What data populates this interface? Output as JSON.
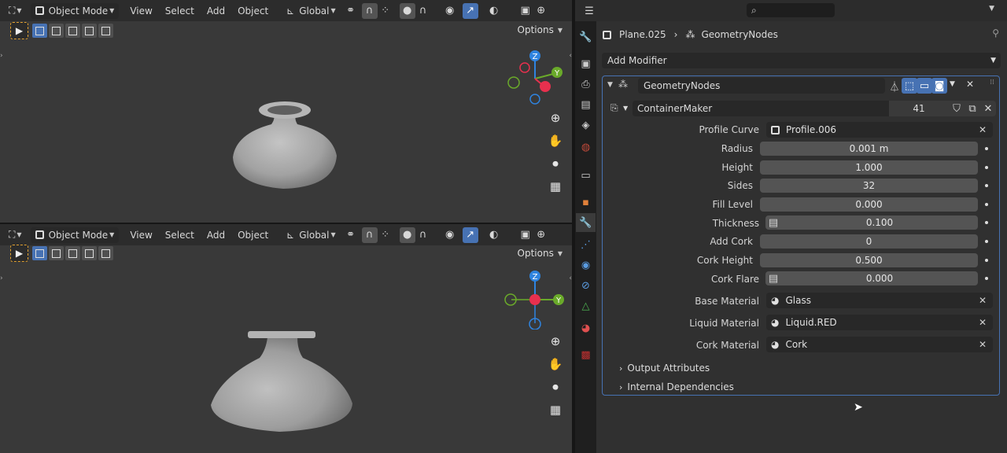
{
  "viewport_top": {
    "mode": "Object Mode",
    "menus": [
      "View",
      "Select",
      "Add",
      "Object"
    ],
    "transform_orientation": "Global",
    "options": "Options",
    "gizmo": {
      "z": "Z",
      "y": "Y"
    }
  },
  "viewport_bottom": {
    "mode": "Object Mode",
    "menus": [
      "View",
      "Select",
      "Add",
      "Object"
    ],
    "transform_orientation": "Global",
    "options": "Options",
    "gizmo": {
      "z": "Z",
      "y": "Y"
    }
  },
  "properties": {
    "breadcrumb": {
      "object": "Plane.025",
      "modifier": "GeometryNodes"
    },
    "add_modifier": "Add Modifier",
    "modifier": {
      "name": "GeometryNodes",
      "node_group": "ContainerMaker",
      "users": "41",
      "inputs": [
        {
          "label": "Profile Curve",
          "value": "Profile.006",
          "kind": "object"
        },
        {
          "label": "Radius",
          "value": "0.001 m",
          "kind": "number"
        },
        {
          "label": "Height",
          "value": "1.000",
          "kind": "number"
        },
        {
          "label": "Sides",
          "value": "32",
          "kind": "number"
        },
        {
          "label": "Fill Level",
          "value": "0.000",
          "kind": "number"
        },
        {
          "label": "Thickness",
          "value": "0.100",
          "kind": "number-attr"
        },
        {
          "label": "Add Cork",
          "value": "0",
          "kind": "number"
        },
        {
          "label": "Cork Height",
          "value": "0.500",
          "kind": "number"
        },
        {
          "label": "Cork Flare",
          "value": "0.000",
          "kind": "number-attr"
        },
        {
          "label": "Base Material",
          "value": "Glass",
          "kind": "material"
        },
        {
          "label": "Liquid Material",
          "value": "Liquid.RED",
          "kind": "material"
        },
        {
          "label": "Cork Material",
          "value": "Cork",
          "kind": "material"
        }
      ],
      "panels": [
        "Output Attributes",
        "Internal Dependencies"
      ]
    }
  },
  "colors": {
    "accent": "#4772b3",
    "x_axis": "#e8304e",
    "y_axis": "#6aaa2a",
    "z_axis": "#2f84e0"
  }
}
